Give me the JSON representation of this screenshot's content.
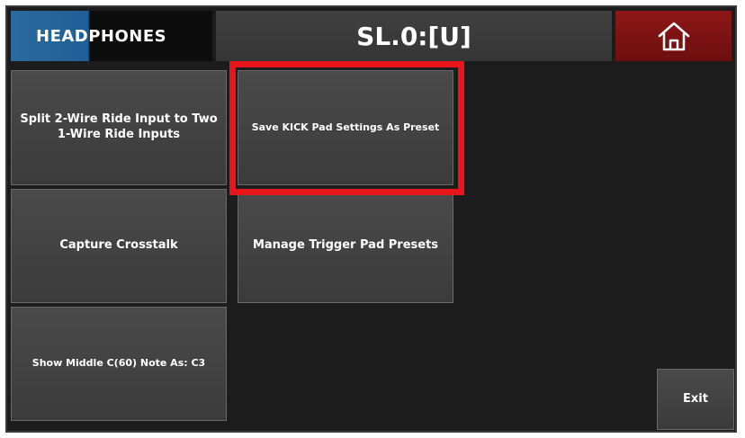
{
  "header": {
    "headphones_label": "HEADPHONES",
    "title": "SL.0:[U]",
    "home_icon": "home-icon"
  },
  "buttons": {
    "split_ride": "Split 2-Wire Ride Input to Two 1-Wire Ride Inputs",
    "save_kick_preset": "Save KICK Pad Settings As Preset",
    "capture_crosstalk": "Capture Crosstalk",
    "manage_presets": "Manage Trigger Pad Presets",
    "show_middle_c": "Show Middle C(60) Note As: C3",
    "exit": "Exit"
  },
  "colors": {
    "home_bg": "#8e1717",
    "headphones_accent": "#2a6a9e",
    "highlight": "#e8151b"
  }
}
